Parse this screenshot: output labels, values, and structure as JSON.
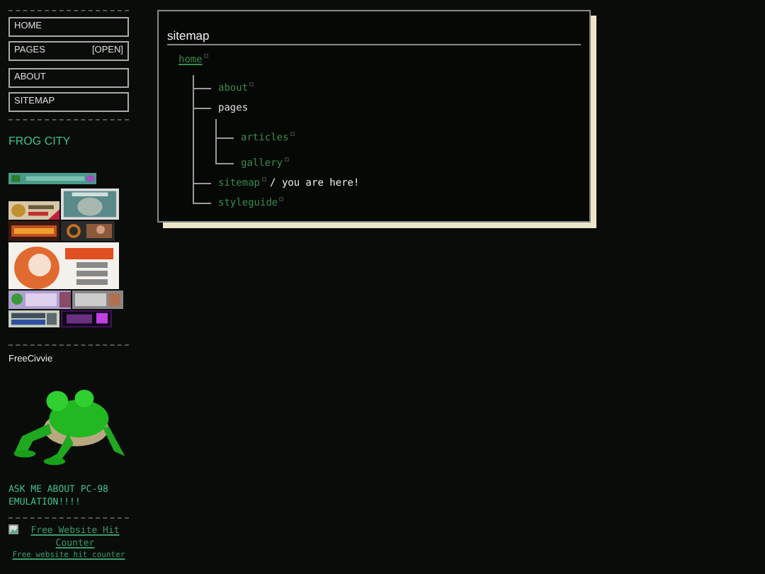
{
  "sidebar": {
    "nav_groups": [
      [
        {
          "label": "HOME"
        },
        {
          "label": "PAGES",
          "badge": "[OPEN]"
        }
      ],
      [
        {
          "label": "ABOUT"
        },
        {
          "label": "SITEMAP"
        }
      ]
    ],
    "site_title": "FROG CITY",
    "badge_rows": [
      [
        {
          "kind": "picture"
        }
      ],
      [
        {
          "kind": "picture"
        },
        {
          "kind": "picture"
        }
      ],
      [
        {
          "kind": "picture"
        },
        {
          "kind": "picture"
        }
      ],
      [
        {
          "kind": "picture"
        }
      ],
      [
        {
          "kind": "picture"
        },
        {
          "kind": "picture"
        }
      ],
      [
        {
          "kind": "picture"
        },
        {
          "kind": "picture"
        }
      ]
    ],
    "civvie": "FreeCivvie",
    "mascot": {
      "kind": "picture"
    },
    "pc98": "ASK ME ABOUT PC-98 EMULATION!!!!",
    "counter": {
      "link": "Free Website Hit Counter",
      "caption": "Free website hit counter"
    }
  },
  "main": {
    "title": "sitemap",
    "tree": [
      {
        "label": "home",
        "link": true,
        "children": [
          {
            "label": "about",
            "link": true
          },
          {
            "label": "pages",
            "link": false,
            "children": [
              {
                "label": "articles",
                "link": true
              },
              {
                "label": "gallery",
                "link": true
              }
            ]
          },
          {
            "label": "sitemap",
            "link": true,
            "note": "/ you are here!"
          },
          {
            "label": "styleguide",
            "link": true
          }
        ]
      }
    ]
  }
}
